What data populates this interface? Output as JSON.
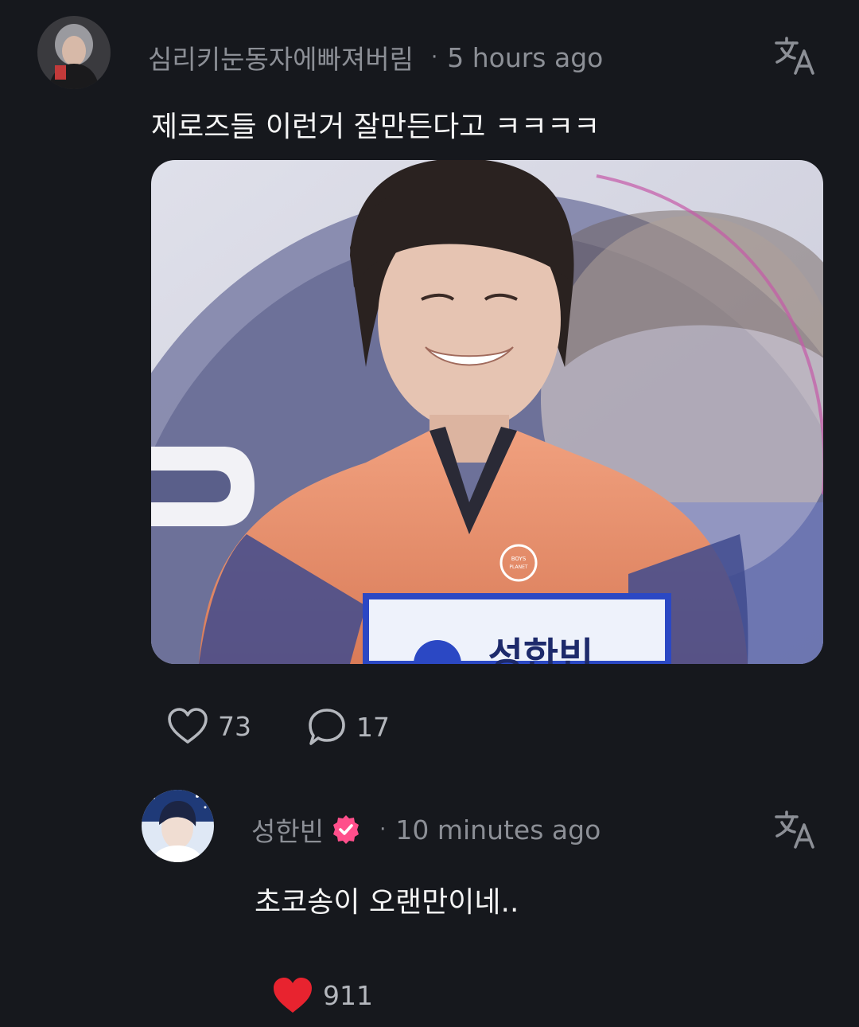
{
  "comment": {
    "username": "심리키눈동자에빠져버림",
    "time": "5 hours ago",
    "text": "제로즈들 이런거 잘만든다고 ㅋㅋㅋㅋ",
    "likes": "73",
    "replies": "17",
    "image": {
      "jersey_logo": "BOYS PLANET",
      "name_tag": "성한빈"
    }
  },
  "reply": {
    "username": "성한빈",
    "time": "10 minutes ago",
    "text": "초코송이 오랜만이네..",
    "likes": "911"
  },
  "icons": {
    "translate": "translate-icon",
    "heart_outline": "heart-outline-icon",
    "comment": "comment-bubble-icon",
    "heart_filled": "heart-filled-icon",
    "verified": "verified-badge-icon"
  },
  "colors": {
    "background": "#16181d",
    "meta_text": "#8c8f96",
    "like_red": "#e8232f",
    "verified_pink": "#ff4f8b"
  }
}
